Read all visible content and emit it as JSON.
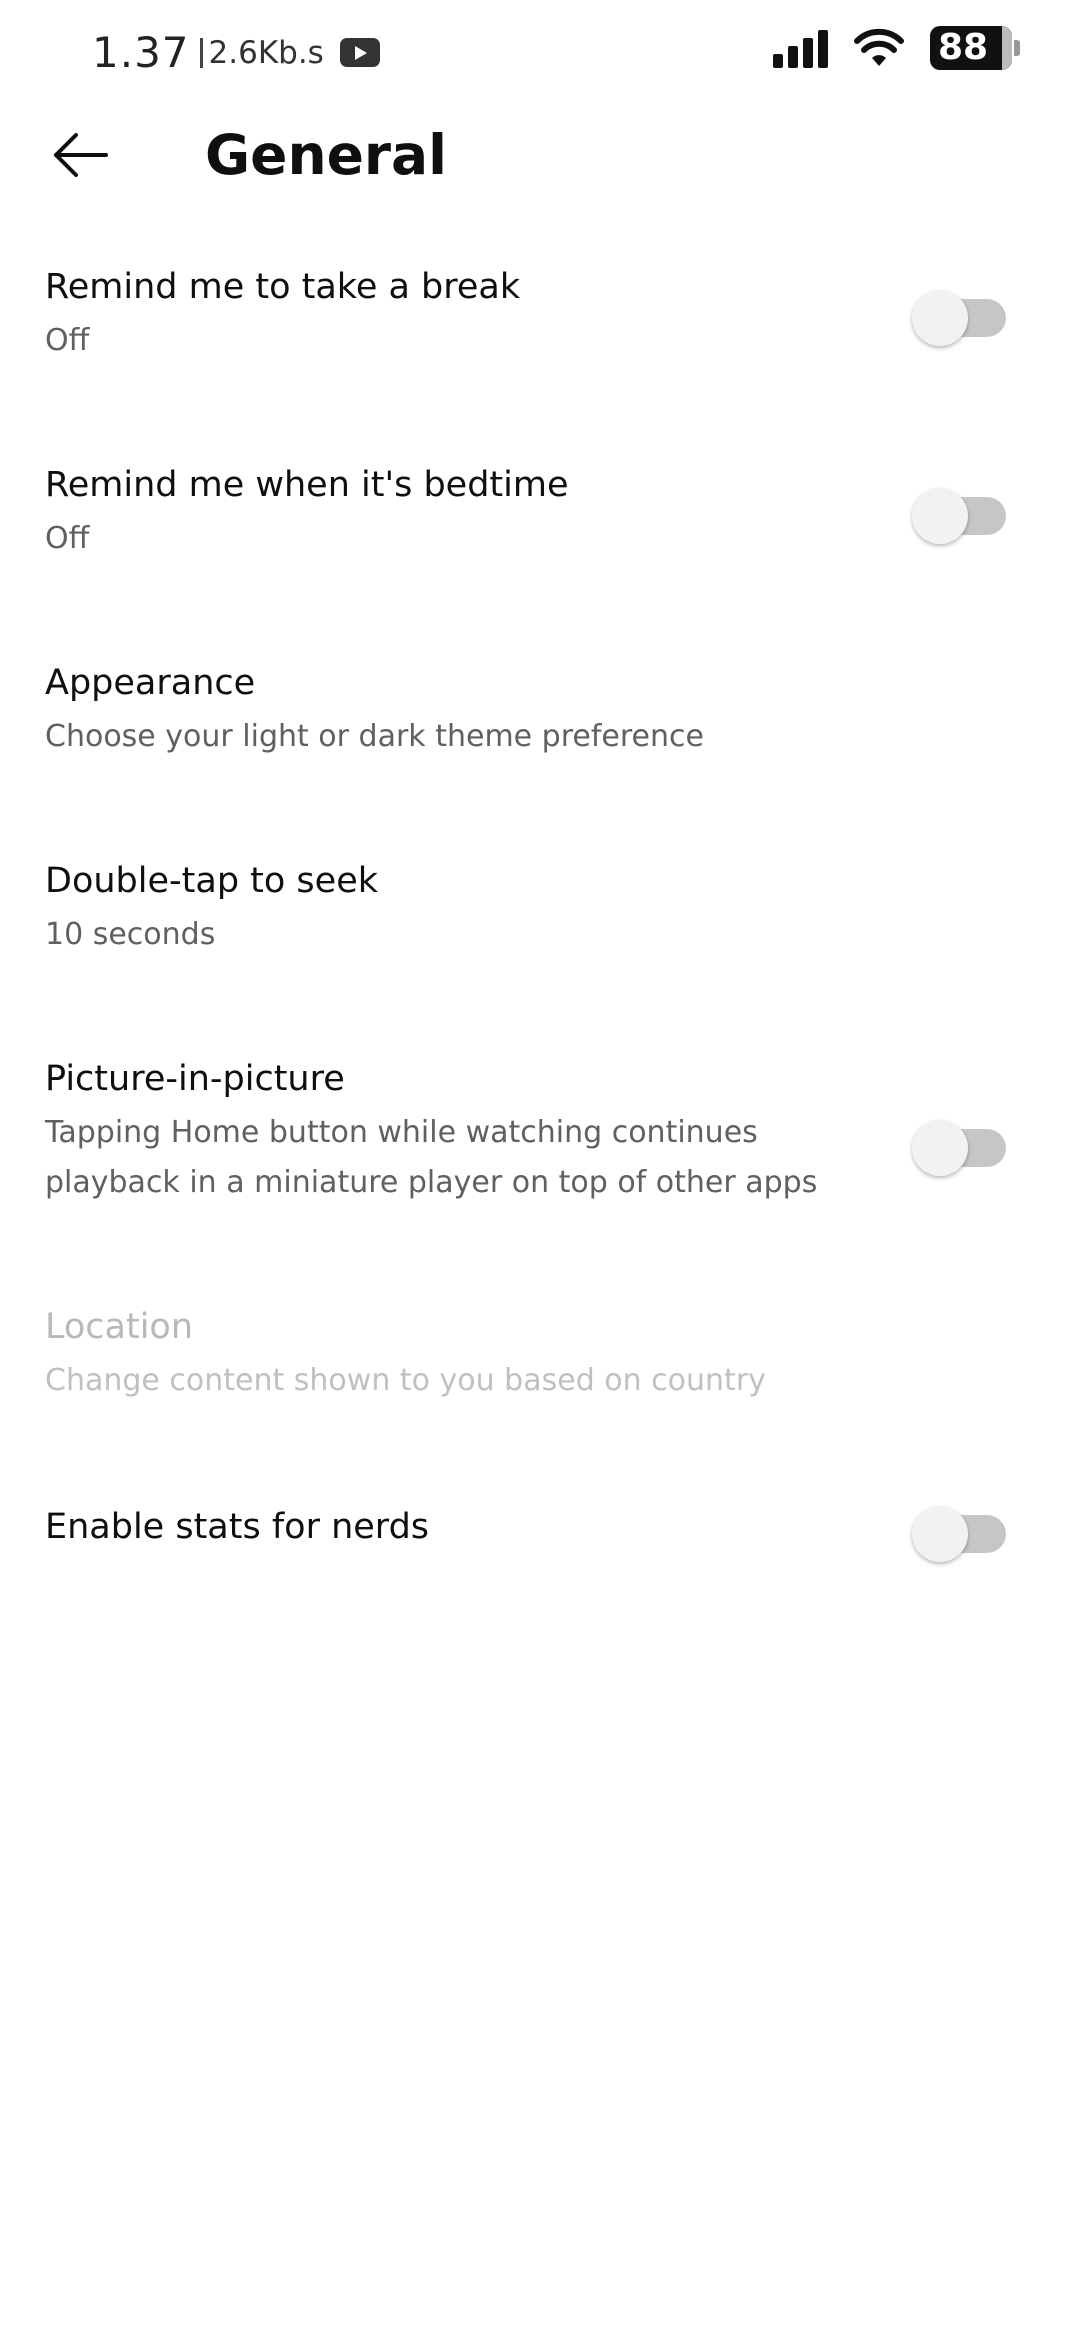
{
  "status_bar": {
    "time": "1.37",
    "net_speed": "2.6Kb.s",
    "battery": "88",
    "notification_icon": "youtube-icon",
    "signal_icon": "signal-icon",
    "wifi_icon": "wifi-icon"
  },
  "header": {
    "title": "General",
    "back_icon": "arrow-left-icon"
  },
  "settings": [
    {
      "title": "Remind me to take a break",
      "subtitle": "Off",
      "toggle": false,
      "enabled": true
    },
    {
      "title": "Remind me when it's bedtime",
      "subtitle": "Off",
      "toggle": false,
      "enabled": true
    },
    {
      "title": "Appearance",
      "subtitle": "Choose your light or dark theme preference",
      "enabled": true
    },
    {
      "title": "Double-tap to seek",
      "subtitle": "10 seconds",
      "enabled": true
    },
    {
      "title": "Picture-in-picture",
      "subtitle": "Tapping Home button while watching continues playback in a miniature player on top of other apps",
      "toggle": false,
      "enabled": true
    },
    {
      "title": "Location",
      "subtitle": "Change content shown to you based on country",
      "enabled": false
    },
    {
      "title": "Enable stats for nerds",
      "toggle": false,
      "enabled": true
    }
  ],
  "colors": {
    "text_primary": "#0f0f0f",
    "text_secondary": "#606060",
    "text_disabled": "#b8b8b8",
    "toggle_track_off": "#c6c6c6",
    "toggle_thumb_off": "#f2f2f2"
  }
}
